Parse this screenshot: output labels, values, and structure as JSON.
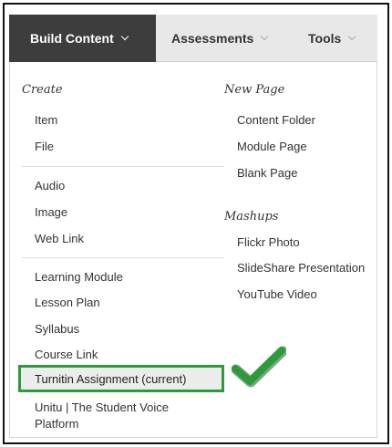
{
  "menu": {
    "tabs": [
      {
        "label": "Build Content",
        "active": true
      },
      {
        "label": "Assessments",
        "active": false
      },
      {
        "label": "Tools",
        "active": false
      }
    ]
  },
  "left": {
    "heading": "Create",
    "items": [
      "Item",
      "File",
      "Audio",
      "Image",
      "Web Link",
      "Learning Module",
      "Lesson Plan",
      "Syllabus",
      "Course Link",
      "Turnitin Assignment (current)",
      "Unitu | The Student Voice",
      "Platform"
    ]
  },
  "right": {
    "new_page_heading": "New Page",
    "new_page_items": [
      "Content Folder",
      "Module Page",
      "Blank Page"
    ],
    "mashups_heading": "Mashups",
    "mashups_items": [
      "Flickr Photo",
      "SlideShare Presentation",
      "YouTube Video"
    ]
  },
  "highlight": {
    "color": "#2e9b3a",
    "icon": "checkmark-icon"
  },
  "colors": {
    "active_tab": "#3d3d3d",
    "menubar": "#e8e8e8"
  }
}
